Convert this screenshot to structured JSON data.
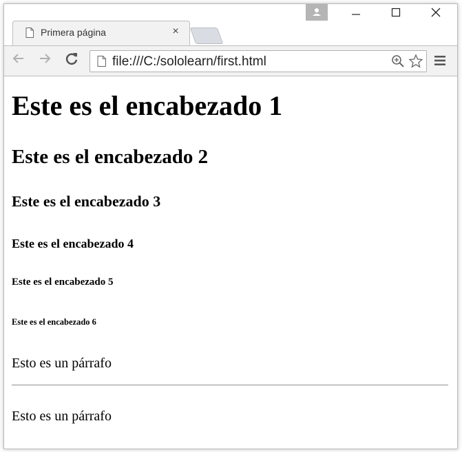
{
  "browser": {
    "tab": {
      "title": "Primera página",
      "close_glyph": "×"
    },
    "window_controls": {
      "minimize": "—",
      "maximize": "☐",
      "close": "✕"
    },
    "toolbar": {
      "back_glyph": "←",
      "forward_glyph": "→",
      "reload_glyph": "C",
      "url": "file:///C:/sololearn/first.html"
    },
    "icons": [
      "page-icon",
      "close-icon",
      "new-tab-icon",
      "profile-icon",
      "minimize-icon",
      "maximize-icon",
      "close-window-icon",
      "back-icon",
      "forward-icon",
      "reload-icon",
      "zoom-icon",
      "bookmark-star-icon",
      "menu-icon"
    ]
  },
  "page": {
    "h1": "Este es el encabezado 1",
    "h2": "Este es el encabezado 2",
    "h3": "Este es el encabezado 3",
    "h4": "Este es el encabezado 4",
    "h5": "Este es el encabezado 5",
    "h6": "Este es el encabezado 6",
    "paragraph_1": "Esto es un párrafo",
    "paragraph_2": "Esto es un párrafo"
  }
}
